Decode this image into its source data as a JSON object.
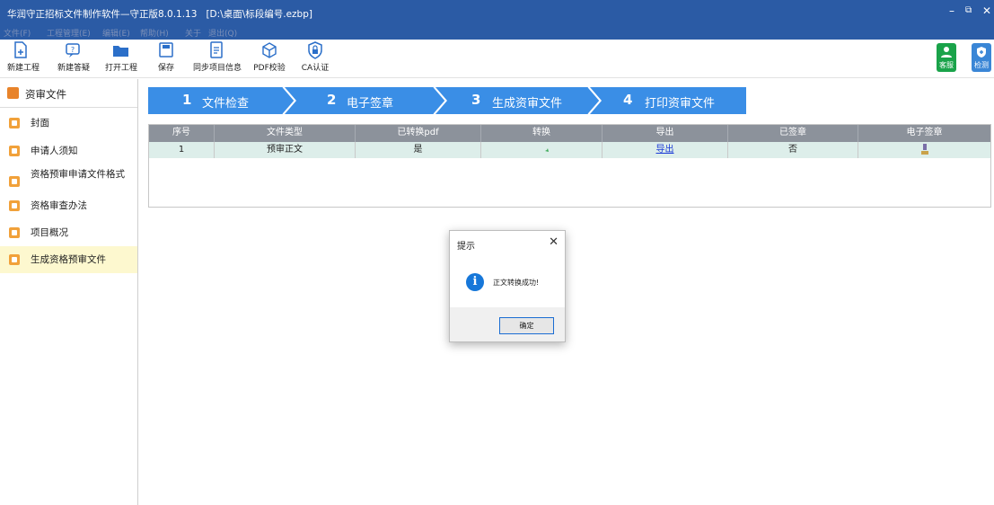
{
  "window": {
    "title": "华润守正招标文件制作软件—守正版8.0.1.13",
    "path": "[D:\\桌面\\标段编号.ezbp]",
    "controls": [
      "–",
      "⧉",
      "✕"
    ]
  },
  "menu": [
    "文件(F)",
    "工程管理(E)",
    "编辑(E)",
    "帮助(H)",
    "关于",
    "退出(Q)"
  ],
  "toolbar": {
    "new_project": "新建工程",
    "new_answer": "新建答疑",
    "open_project": "打开工程",
    "save": "保存",
    "sync_info": "同步项目信息",
    "pdf_check": "PDF校验",
    "ca_auth": "CA认证",
    "service": "客服",
    "detect": "检测"
  },
  "sidebar": {
    "header": "资审文件",
    "items": [
      {
        "label": "封面",
        "active": false
      },
      {
        "label": "申请人须知",
        "active": false
      },
      {
        "label": "资格预审申请文件格式",
        "active": false
      },
      {
        "label": "资格审查办法",
        "active": false
      },
      {
        "label": "项目概况",
        "active": false
      },
      {
        "label": "生成资格预审文件",
        "active": true
      }
    ]
  },
  "steps": [
    {
      "num": "1",
      "label": "文件检查"
    },
    {
      "num": "2",
      "label": "电子签章"
    },
    {
      "num": "3",
      "label": "生成资审文件"
    },
    {
      "num": "4",
      "label": "打印资审文件"
    }
  ],
  "table": {
    "columns": [
      "序号",
      "文件类型",
      "已转换pdf",
      "转换",
      "导出",
      "已签章",
      "电子签章"
    ],
    "rows": [
      {
        "index": "1",
        "type": "预审正文",
        "converted": "是",
        "convert_icon": "convert-icon",
        "export": "导出",
        "signed": "否",
        "sign_icon": "stamp-icon"
      }
    ]
  },
  "dialog": {
    "title": "提示",
    "message": "正文转换成功!",
    "ok": "确定"
  },
  "colors": {
    "titlebar": "#2b5ba5",
    "step": "#3a8ee6",
    "table_header": "#8c929b",
    "row": "#ddeeea",
    "active_item": "#fdf8cf",
    "service": "#1aa34a",
    "detect": "#3a86d6"
  }
}
